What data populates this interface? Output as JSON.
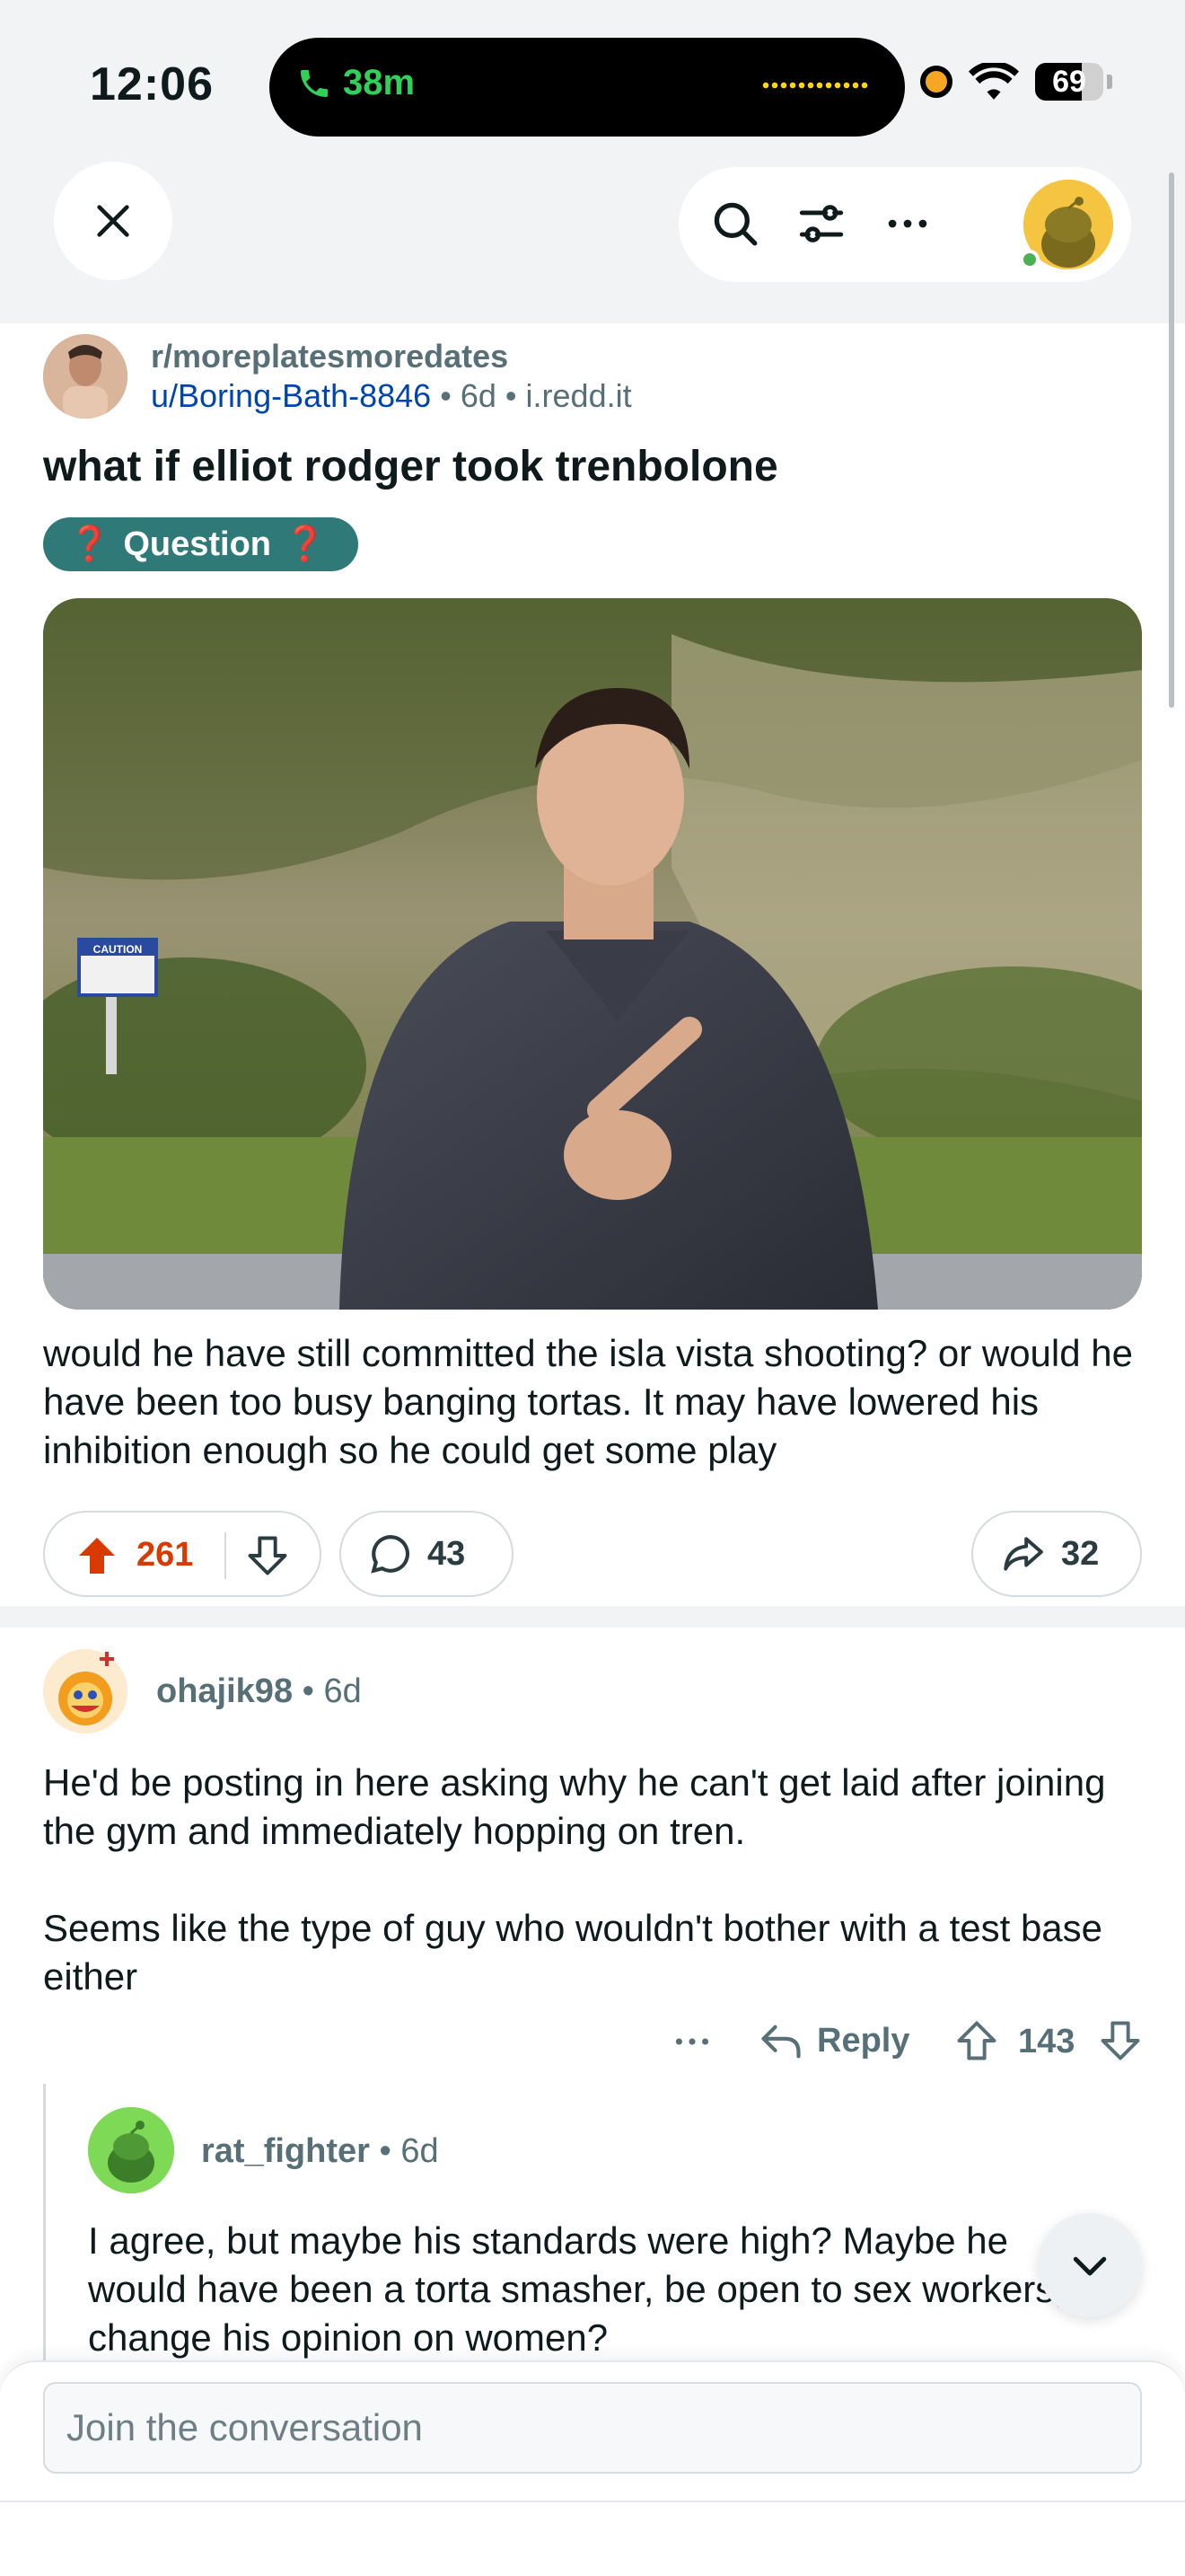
{
  "status_bar": {
    "time": "12:06",
    "call_duration": "38m",
    "battery": "69",
    "battery_level": 0.69
  },
  "header": {
    "icons": [
      "close-icon",
      "search-icon",
      "filter-icon",
      "more-icon",
      "user-avatar"
    ]
  },
  "post": {
    "subreddit": "r/moreplatesmoredates",
    "author": "u/Boring-Bath-8846",
    "age": "6d",
    "domain": "i.redd.it",
    "separator": "•",
    "title": "what if elliot rodger took trenbolone",
    "flair": {
      "icon_left": "❓",
      "label": "Question",
      "icon_right": "❓",
      "color": "#2f7a78"
    },
    "image_sign": "CAUTION",
    "body": "would he have still committed the isla vista shooting? or would he have been too busy banging tortas. It may have lowered his inhibition enough so he could get some play",
    "upvotes": "261",
    "comments": "43",
    "shares": "32",
    "upvote_color": "#d93a00"
  },
  "comments": [
    {
      "author": "ohajik98",
      "age": "6d",
      "separator": "•",
      "body_p1": "He'd be posting in here asking why he can't get laid after joining the gym and immediately hopping on tren.",
      "body_p2": "Seems like the type of guy who wouldn't bother with a test base either",
      "reply_label": "Reply",
      "score": "143"
    },
    {
      "author": "rat_fighter",
      "age": "6d",
      "separator": "•",
      "body": "I agree, but maybe his standards were high? Maybe he would have been a torta smasher, be open to sex workers, change his opinion on women?"
    }
  ],
  "composer": {
    "placeholder": "Join the conversation"
  }
}
